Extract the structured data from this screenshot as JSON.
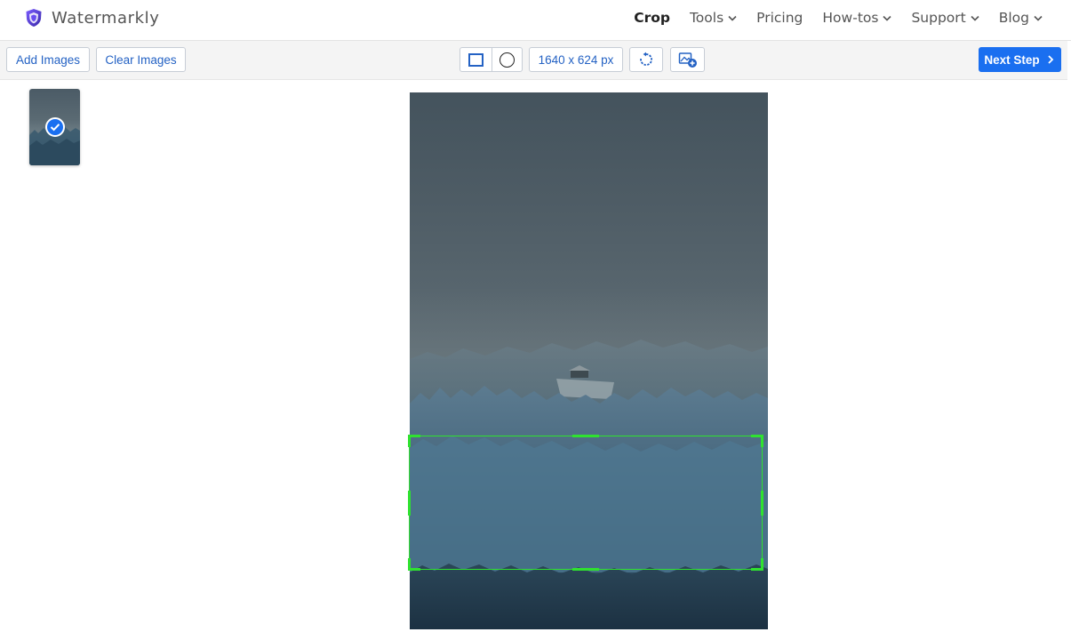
{
  "header": {
    "brand": "Watermarkly",
    "nav": [
      {
        "label": "Crop",
        "active": true,
        "dropdown": false
      },
      {
        "label": "Tools",
        "dropdown": true
      },
      {
        "label": "Pricing",
        "dropdown": false
      },
      {
        "label": "How-tos",
        "dropdown": true
      },
      {
        "label": "Support",
        "dropdown": true
      },
      {
        "label": "Blog",
        "dropdown": true
      }
    ]
  },
  "toolbar": {
    "add_images": "Add Images",
    "clear_images": "Clear Images",
    "dimensions": "1640 x 624 px",
    "next_step": "Next Step",
    "icons": [
      "rectangle-shape-icon",
      "circle-shape-icon",
      "rotate-icon",
      "add-image-icon"
    ]
  },
  "colors": {
    "accent": "#1a6ff0",
    "crop_frame": "#2fe22f",
    "brand_shield": "#5b3fd6"
  }
}
